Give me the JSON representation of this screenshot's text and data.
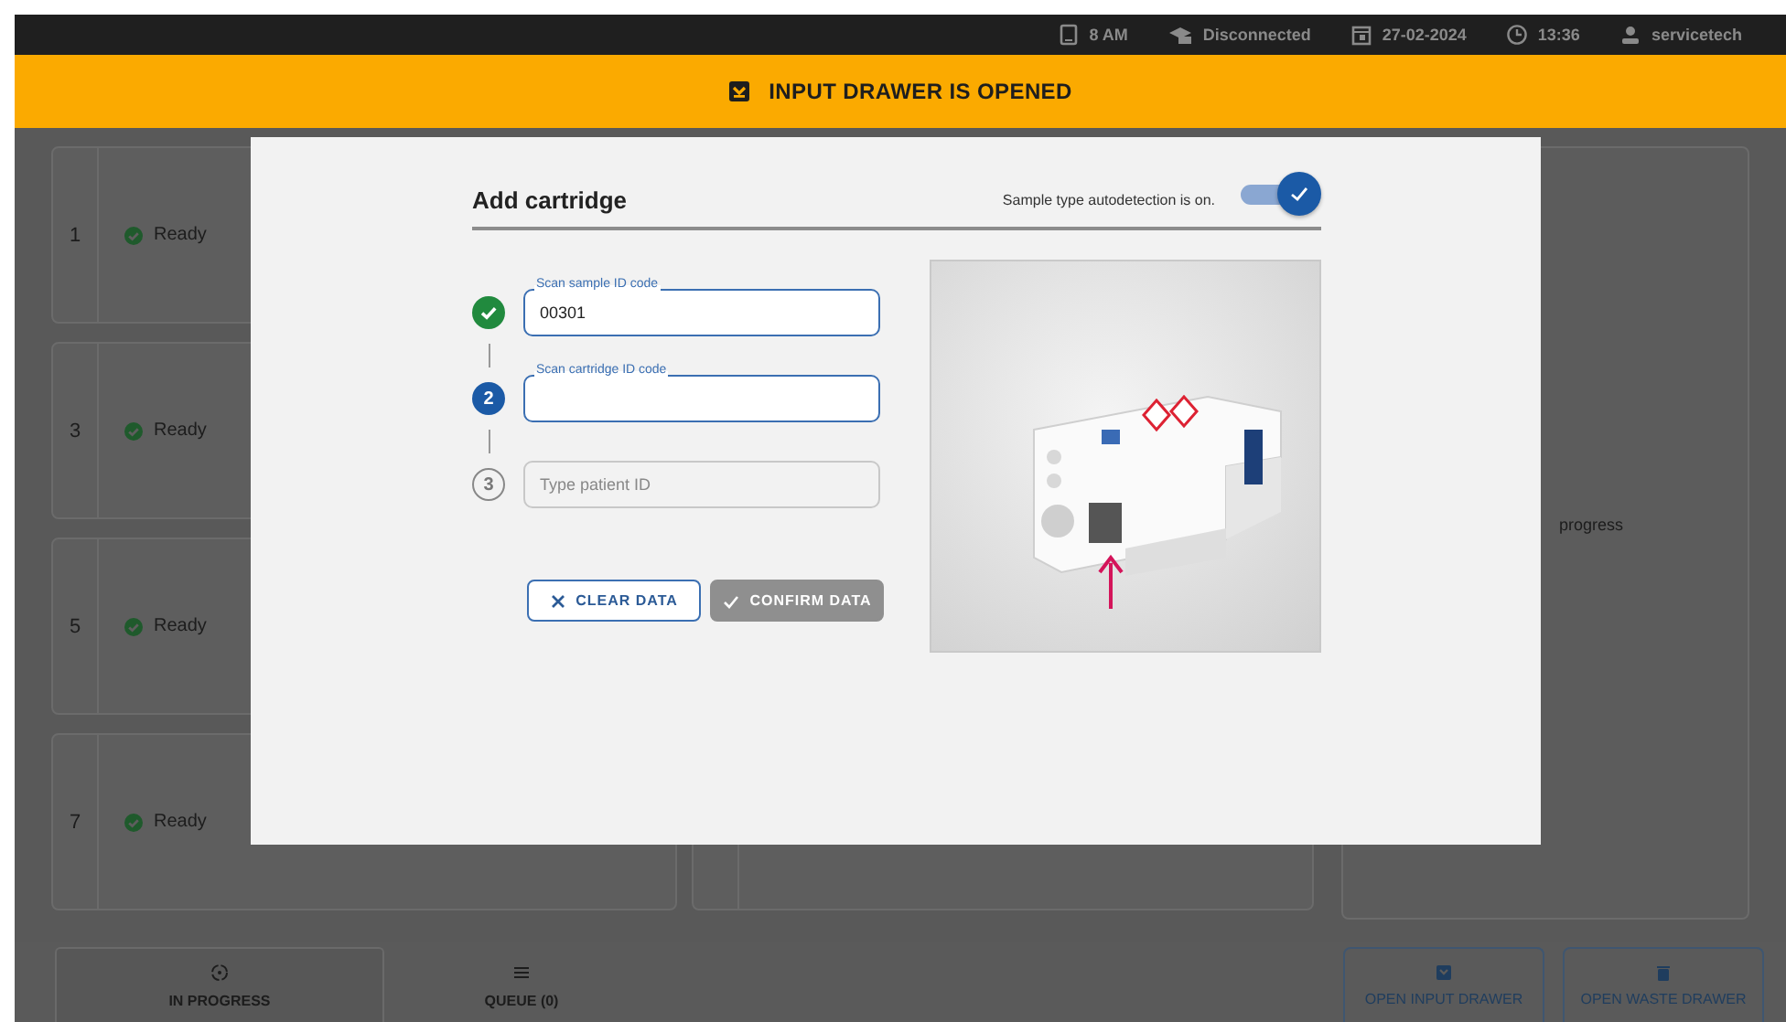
{
  "status_bar": [
    {
      "kind": "tablet",
      "text": "8 AM"
    },
    {
      "kind": "network",
      "text": "Disconnected"
    },
    {
      "kind": "calendar",
      "text": "27-02-2024"
    },
    {
      "kind": "clock",
      "text": "13:36"
    },
    {
      "kind": "user",
      "text": "servicetech"
    }
  ],
  "banner": {
    "text": "INPUT DRAWER IS OPENED"
  },
  "slots": [
    {
      "number": "1",
      "status": "Ready"
    },
    {
      "number": "3",
      "status": "Ready"
    },
    {
      "number": "5",
      "status": "Ready"
    },
    {
      "number": "7",
      "status": "Ready"
    }
  ],
  "right_panel": {
    "text": "progress"
  },
  "bottom_tabs": [
    {
      "label": "IN PROGRESS",
      "kind": "progress",
      "selected": true
    },
    {
      "label": "QUEUE (0)",
      "kind": "queue",
      "selected": false
    }
  ],
  "drawer_buttons": [
    {
      "kind": "input",
      "label": "OPEN INPUT DRAWER"
    },
    {
      "kind": "waste",
      "label": "OPEN WASTE DRAWER"
    }
  ],
  "dialog": {
    "title": "Add cartridge",
    "autodetect": {
      "label": "Sample type autodetection is on.",
      "on": true
    },
    "steps": [
      {
        "kind": "done",
        "label": "Scan sample ID code",
        "value": "00301"
      },
      {
        "kind": "active",
        "number": "2",
        "label": "Scan cartridge ID code"
      },
      {
        "kind": "pending",
        "number": "3",
        "placeholder": "Type patient ID"
      }
    ],
    "buttons": [
      {
        "kind": "clear",
        "label": "CLEAR DATA",
        "disabled": false
      },
      {
        "kind": "confirm",
        "label": "CONFIRM DATA",
        "disabled": true
      }
    ]
  }
}
